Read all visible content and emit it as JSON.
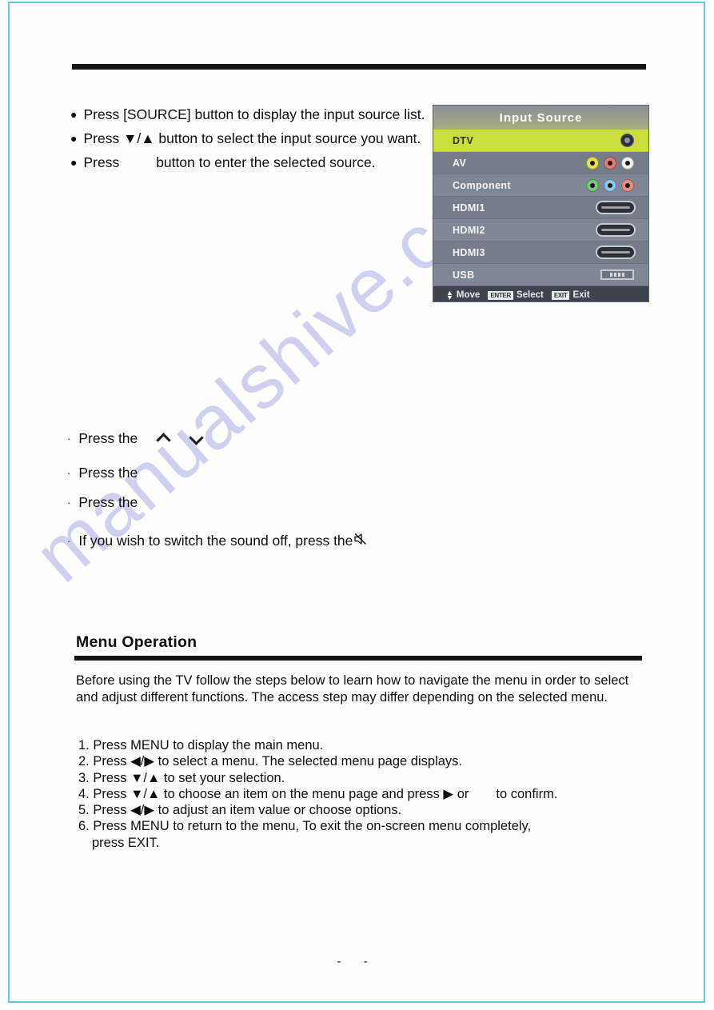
{
  "page": {
    "number_text": "-  -",
    "watermark": "manualshive.com",
    "border_color": "#69c3e6"
  },
  "source_steps": {
    "items": [
      {
        "bullet": "●",
        "text": "Press [SOURCE] button to display the input source list."
      },
      {
        "bullet": "●",
        "text": "Press ▼/▲ button to select the input  source you want."
      },
      {
        "bullet": "●",
        "prefix": "Press",
        "text": "button to enter the selected source."
      }
    ]
  },
  "input_source": {
    "title": "Input  Source",
    "rows": [
      {
        "label": "DTV",
        "selected": true,
        "icon": "coax-connector-icon"
      },
      {
        "label": "AV",
        "selected": false,
        "icon": "rca-av-jacks-icon"
      },
      {
        "label": "Component",
        "selected": false,
        "icon": "rca-component-jacks-icon"
      },
      {
        "label": "HDMI1",
        "selected": false,
        "icon": "hdmi-port-icon"
      },
      {
        "label": "HDMI2",
        "selected": false,
        "icon": "hdmi-port-icon"
      },
      {
        "label": "HDMI3",
        "selected": false,
        "icon": "hdmi-port-icon"
      },
      {
        "label": "USB",
        "selected": false,
        "icon": "usb-port-icon"
      }
    ],
    "footer": {
      "move_label": "Move",
      "enter_key": "ENTER",
      "select_label": "Select",
      "exit_key": "EXIT",
      "exit_label": "Exit"
    },
    "colors": {
      "selected_row": "#cade3c",
      "row": "#767d8a",
      "footer": "#3d4450"
    }
  },
  "middle_steps": {
    "items": [
      {
        "bullet": "·",
        "text": "Press the",
        "icons": [
          "chevron-up-icon",
          "chevron-down-icon"
        ]
      },
      {
        "bullet": "·",
        "text": "Press the",
        "icons": []
      },
      {
        "bullet": "·",
        "text": "Press the",
        "icons": []
      },
      {
        "bullet": "·",
        "text": "If you wish to switch the sound off, press the",
        "icons": [
          "mute-icon"
        ]
      }
    ]
  },
  "menu_operation": {
    "heading": "Menu Operation",
    "intro": "Before using the TV follow the steps below to learn how to navigate the menu in order to select and adjust different functions. The access step may differ depending on the selected menu.",
    "steps": [
      "1. Press MENU to display the main menu.",
      "2. Press ◀/▶ to select a menu. The selected menu page displays.",
      "3. Press ▼/▲ to set your selection.",
      "5. Press ◀/▶ to adjust an item value or choose options.",
      "6. Press MENU to return to the menu, To exit the on-screen menu completely,"
    ],
    "step4_part1": "4. Press ▼/▲ to choose an item on the menu page and press ▶ or",
    "step4_part2": "to confirm.",
    "step6_continuation": "press EXIT."
  }
}
